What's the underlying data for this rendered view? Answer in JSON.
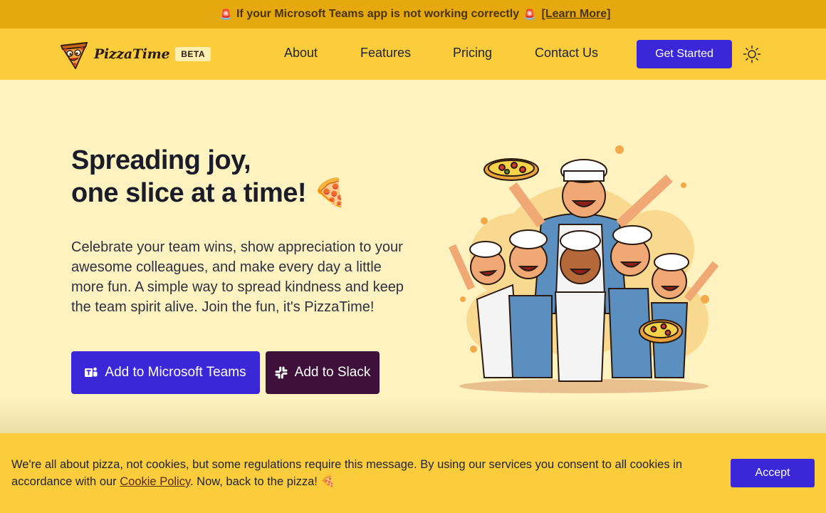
{
  "banner": {
    "siren_icon": "🚨",
    "message": "If your Microsoft Teams app is not working correctly",
    "link_label": "[Learn More]"
  },
  "nav": {
    "logo_text": "PizzaTime",
    "beta_badge": "BETA",
    "links": [
      "About",
      "Features",
      "Pricing",
      "Contact Us"
    ],
    "cta_label": "Get Started",
    "theme_icon": "sun-icon"
  },
  "hero": {
    "title_line1": "Spreading joy,",
    "title_line2": "one slice at a time!",
    "title_emoji": "🍕",
    "body": "Celebrate your team wins, show appreciation to your awesome colleagues, and make every day a little more fun. A simple way to spread kindness and keep the team spirit alive. Join the fun, it's PizzaTime!",
    "teams_button": "Add to Microsoft Teams",
    "slack_button": "Add to Slack"
  },
  "cookie": {
    "text_before": "We're all about pizza, not cookies, but some regulations require this message. By using our services you consent to all cookies in accordance with our ",
    "link_label": "Cookie Policy",
    "text_after": ". Now, back to the pizza! 🍕",
    "accept_label": "Accept"
  },
  "colors": {
    "banner": "#e6a80f",
    "navbar": "#fbcd3c",
    "background": "#fef3c0",
    "primary": "#3a28d8",
    "slack": "#3d1139"
  }
}
